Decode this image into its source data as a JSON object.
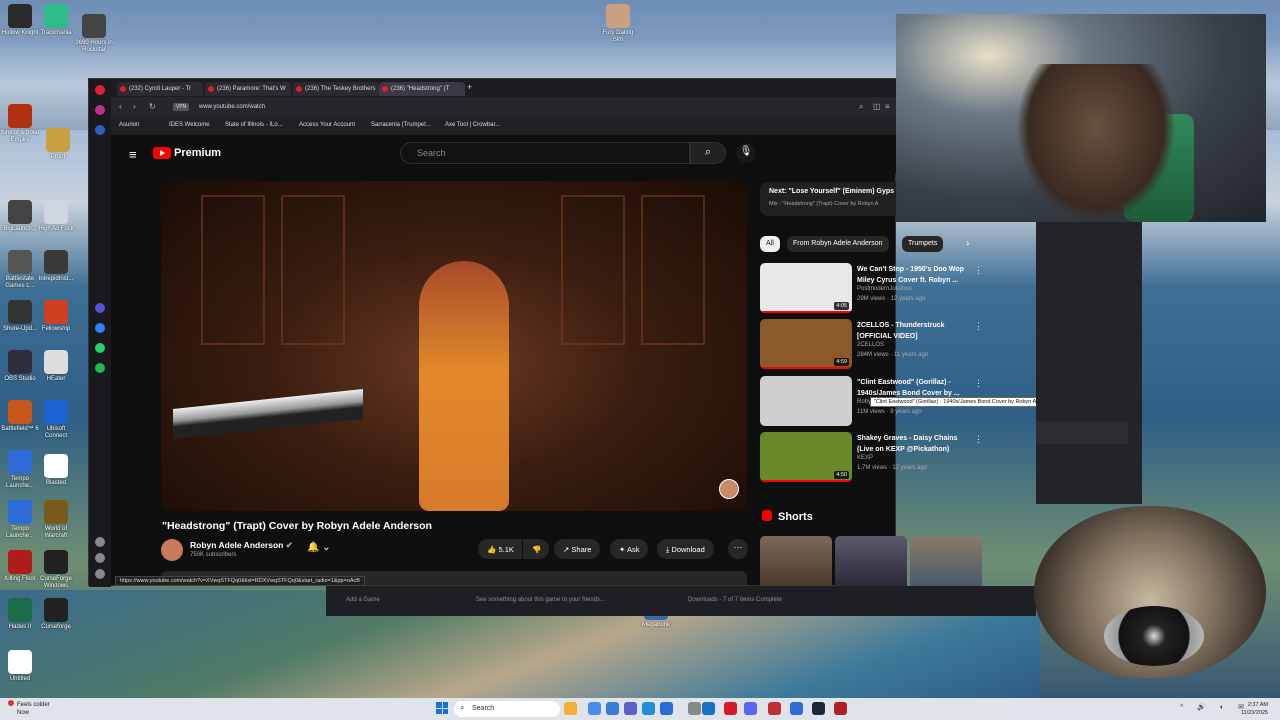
{
  "desktop": {
    "icons_left": [
      {
        "label": "Hollow Knight",
        "color": "#2b2b2b"
      },
      {
        "label": "Trackmania",
        "color": "#2dbb8a"
      },
      {
        "label": "3690 Hours in Rockstar",
        "color": "#444444"
      },
      {
        "label": "Sins of a Solar Empire",
        "color": "#b03010"
      },
      {
        "label": "Proof",
        "color": "#c8a040"
      },
      {
        "label": "BigLaunch...",
        "color": "#444444"
      },
      {
        "label": "High As Fuck",
        "color": "#cfd8e0"
      },
      {
        "label": "Battlestate Games L...",
        "color": "#555555"
      },
      {
        "label": "IntrepidInst...",
        "color": "#3a3a3a"
      },
      {
        "label": "Shure-Upd...",
        "color": "#333333"
      },
      {
        "label": "Fellowship",
        "color": "#d04020"
      },
      {
        "label": "OBS Studio",
        "color": "#302e3d"
      },
      {
        "label": "HEater",
        "color": "#dddddd"
      },
      {
        "label": "Battlefield™ 6",
        "color": "#c8571b"
      },
      {
        "label": "Ubisoft Connect",
        "color": "#1d62d3"
      },
      {
        "label": "Tempo Launche...",
        "color": "#2f6bd8"
      },
      {
        "label": "Blasted",
        "color": "#ffffff"
      },
      {
        "label": "Tempo Launche...",
        "color": "#2f6bd8"
      },
      {
        "label": "World of Warcraft",
        "color": "#7a5a1a"
      },
      {
        "label": "Killing Floor",
        "color": "#b01c1c"
      },
      {
        "label": "CurseForge Windows",
        "color": "#222222"
      },
      {
        "label": "Hades II",
        "color": "#1c6b4a"
      },
      {
        "label": "Curseforge",
        "color": "#222222"
      },
      {
        "label": "Untitled",
        "color": "#ffffff"
      }
    ],
    "icon_top": {
      "label": "Fury Dating Sim"
    },
    "icon_megabonk": {
      "label": "Megabonk"
    }
  },
  "browser": {
    "tabs": [
      {
        "label": "(232) Cyndi Lauper - Tr"
      },
      {
        "label": "(236) Paramore: That's W"
      },
      {
        "label": "(236) The Teskey Brothers"
      },
      {
        "label": "(236) \"Headstrong\" (T"
      }
    ],
    "url": "www.youtube.com/watch",
    "vpn": "VPN",
    "bookmarks": [
      "Asurion",
      "IDES Welcome",
      "State of Illinois - ILo...",
      "Access Your Account",
      "Sarracenia (Trumpet...",
      "Axe Tool | Crowbar..."
    ]
  },
  "youtube": {
    "brand": "Premium",
    "search_placeholder": "Search",
    "video_title": "\"Headstrong\" (Trapt) Cover by Robyn Adele Anderson",
    "channel_name": "Robyn Adele Anderson",
    "subscribers": "750K subscribers",
    "likes": "5.1K",
    "share": "Share",
    "ask": "Ask",
    "download": "Download",
    "status_url": "https://www.youtube.com/watch?v=XVwqSTFQq0&list=RDXVwqSTFQq0&start_radio=1&pp=oAcB",
    "playlist_title": "Next: \"Lose Yourself\" (Eminem) Gyps",
    "playlist_sub": "Mix - \"Headstrong\" (Trapt) Cover by Robyn A",
    "chips": [
      "All",
      "From Robyn Adele Anderson",
      "Trumpets"
    ],
    "recommendations": [
      {
        "title": "We Can't Stop - 1950's Doo Wop Miley Cyrus Cover ft. Robyn ...",
        "channel": "PostmodernJukebox",
        "meta": "29M views · 12 years ago",
        "duration": "4:05",
        "thumb": "#e8e8e8",
        "progress": 1.0
      },
      {
        "title": "2CELLOS - Thunderstruck [OFFICIAL VIDEO]",
        "channel": "2CELLOS",
        "meta": "284M views · 11 years ago",
        "duration": "4:59",
        "thumb": "#8a5a2a",
        "progress": 1.0
      },
      {
        "title": "\"Clint Eastwood\" (Gorillaz) - 1940s/James Bond Cover by ...",
        "channel": "Robyn Adele Anderson",
        "meta": "11M views · 9 years ago",
        "duration": "",
        "thumb": "#cfcfcf",
        "progress": 0.0
      },
      {
        "title": "Shakey Graves - Daisy Chains (Live on KEXP @Pickathon)",
        "channel": "KEXP",
        "meta": "1.7M views · 12 years ago",
        "duration": "4:50",
        "thumb": "#6a8a2a",
        "progress": 1.0
      }
    ],
    "tooltip": "\"Clint Eastwood\" (Gorillaz) - 1940s/James Bond Cover by Robyn Adele Anderson",
    "shorts_label": "Shorts"
  },
  "steam_bar": {
    "add_game": "Add a Game",
    "placeholder": "See something about this game to your friends...",
    "downloads": "Downloads - 7 of 7 Items Complete"
  },
  "taskbar": {
    "weather_line1": "Feels colder",
    "weather_line2": "Now",
    "search": "Search",
    "time": "2:37 AM",
    "date": "11/23/2025"
  }
}
